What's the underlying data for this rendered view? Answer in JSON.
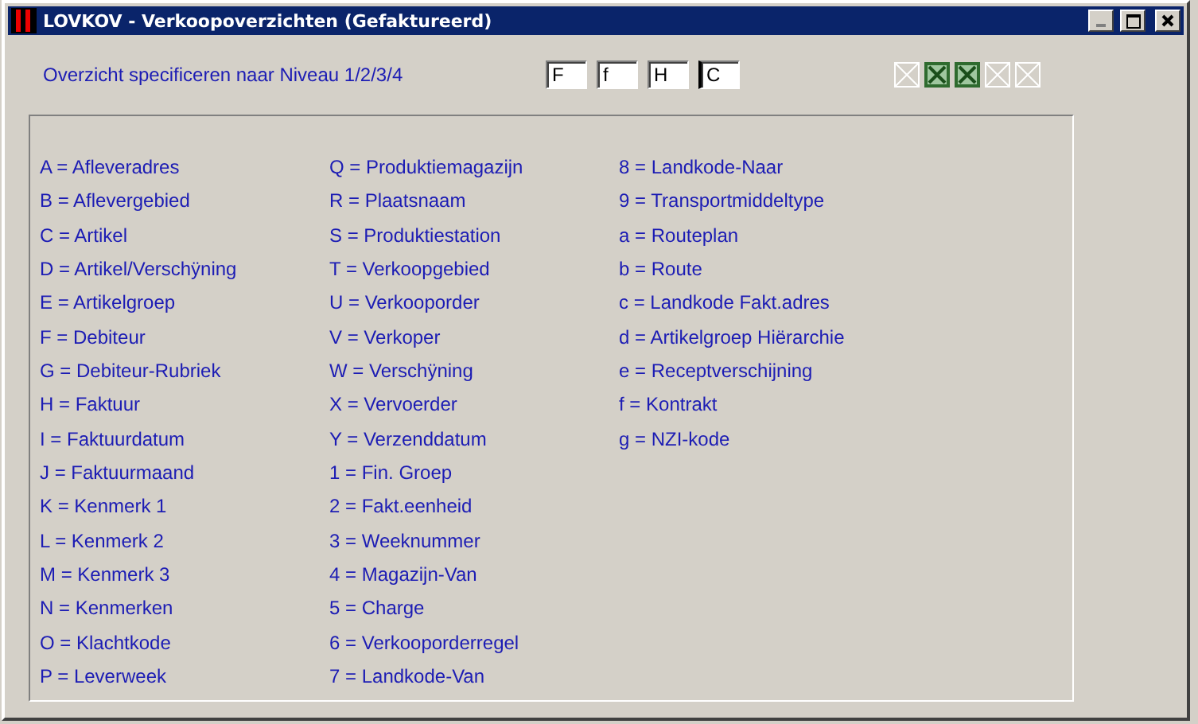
{
  "window": {
    "title": "LOVKOV - Verkoopoverzichten (Gefaktureerd)",
    "controls": [
      {
        "kind": "minimize",
        "disabled": true
      },
      {
        "kind": "maximize",
        "disabled": false
      },
      {
        "kind": "close",
        "disabled": false
      }
    ]
  },
  "prompt": "Overzicht specificeren naar Niveau 1/2/3/4",
  "fields": [
    {
      "value": "F",
      "focused": false
    },
    {
      "value": "f",
      "focused": false
    },
    {
      "value": "H",
      "focused": false
    },
    {
      "value": "C",
      "focused": true
    }
  ],
  "toolbar": [
    {
      "kind": "blank",
      "disabled": true
    },
    {
      "kind": "spreadsheet",
      "disabled": false
    },
    {
      "kind": "spreadsheet",
      "disabled": false
    },
    {
      "kind": "blank",
      "disabled": true
    },
    {
      "kind": "blank",
      "disabled": true
    }
  ],
  "legend": [
    [
      "A = Afleveradres",
      "B = Aflevergebied",
      "C = Artikel",
      "D = Artikel/Verschÿning",
      "E = Artikelgroep",
      "F = Debiteur",
      "G = Debiteur-Rubriek",
      "H = Faktuur",
      "I = Faktuurdatum",
      "J = Faktuurmaand",
      "K = Kenmerk 1",
      "L = Kenmerk 2",
      "M = Kenmerk 3",
      "N = Kenmerken",
      "O = Klachtkode",
      "P = Leverweek"
    ],
    [
      "Q = Produktiemagazijn",
      "R = Plaatsnaam",
      "S = Produktiestation",
      "T = Verkoopgebied",
      "U = Verkooporder",
      "V = Verkoper",
      "W = Verschÿning",
      "X = Vervoerder",
      "Y = Verzenddatum",
      "1 = Fin. Groep",
      "2 = Fakt.eenheid",
      "3 = Weeknummer",
      "4 = Magazijn-Van",
      "5 = Charge",
      "6 = Verkooporderregel",
      "7 = Landkode-Van"
    ],
    [
      "8 = Landkode-Naar",
      "9 = Transportmiddeltype",
      "a = Routeplan",
      "b = Route",
      "c = Landkode Fakt.adres",
      "d = Artikelgroep Hiërarchie",
      "e = Receptverschijning",
      "f = Kontrakt",
      "g = NZI-kode"
    ]
  ]
}
